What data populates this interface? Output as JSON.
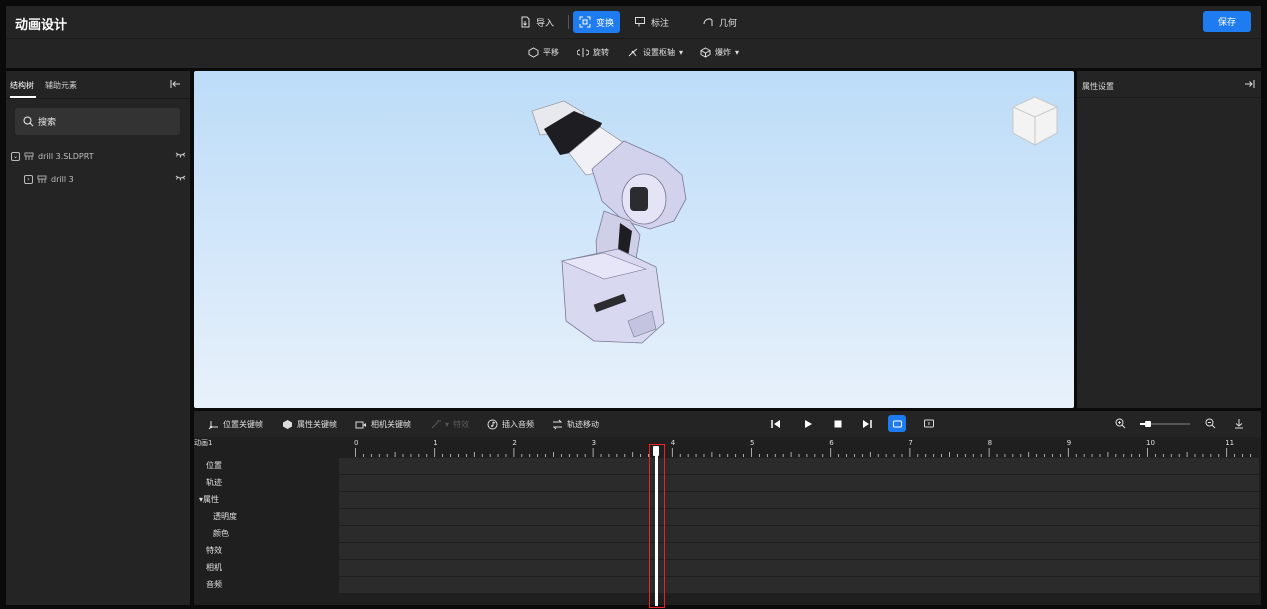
{
  "app": {
    "title": "动画设计",
    "save_label": "保存"
  },
  "toolbar": {
    "import": "导入",
    "transform": "变换",
    "annotate": "标注",
    "geometry": "几何"
  },
  "subtoolbar": {
    "translate": "平移",
    "rotate": "旋转",
    "set_axis": "设置枢轴",
    "explode": "爆炸"
  },
  "left": {
    "tab_tree": "结构树",
    "tab_aux": "辅助元素",
    "search_label": "搜索",
    "tree": [
      {
        "label": "drill 3.SLDPRT"
      },
      {
        "label": "drill 3"
      }
    ]
  },
  "right": {
    "title": "属性设置"
  },
  "timeline": {
    "pos_key": "位置关键帧",
    "attr_key": "属性关键帧",
    "cam_key": "相机关键帧",
    "effect": "特效",
    "insert_audio": "插入音频",
    "track_move": "轨迹移动",
    "anim_name": "动画1",
    "rows": [
      "位置",
      "轨迹",
      "▾属性",
      "透明度",
      "颜色",
      "特效",
      "相机",
      "音频"
    ],
    "ticks": [
      "0",
      "1",
      "2",
      "3",
      "4",
      "5",
      "6",
      "7",
      "8",
      "9",
      "10",
      "11"
    ],
    "zoom_level": 0.15,
    "playhead": 3.8
  },
  "colors": {
    "accent": "#1e7bf0",
    "playhead_box": "#e22222"
  }
}
